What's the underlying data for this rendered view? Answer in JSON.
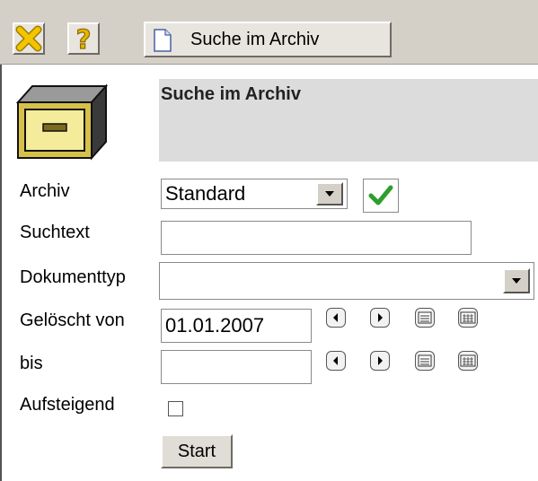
{
  "toolbar": {
    "icons": {
      "close": "close-x-icon",
      "help": "help-question-icon",
      "tab": "document-icon"
    },
    "tab_label": "Suche im Archiv",
    "colors": {
      "close": "#f0c200",
      "help": "#e8b400",
      "check": "#2e9e2e"
    }
  },
  "header": {
    "title": "Suche im Archiv",
    "icon": "archive-box-icon"
  },
  "form": {
    "archiv": {
      "label": "Archiv",
      "value": "Standard"
    },
    "suchtext": {
      "label": "Suchtext",
      "value": ""
    },
    "dokumenttyp": {
      "label": "Dokumenttyp",
      "value": ""
    },
    "geloescht_von": {
      "label": "Gelöscht von",
      "value": "01.01.2007"
    },
    "bis": {
      "label": "bis",
      "value": ""
    },
    "aufsteigend": {
      "label": "Aufsteigend",
      "checked": false
    },
    "start_label": "Start"
  }
}
